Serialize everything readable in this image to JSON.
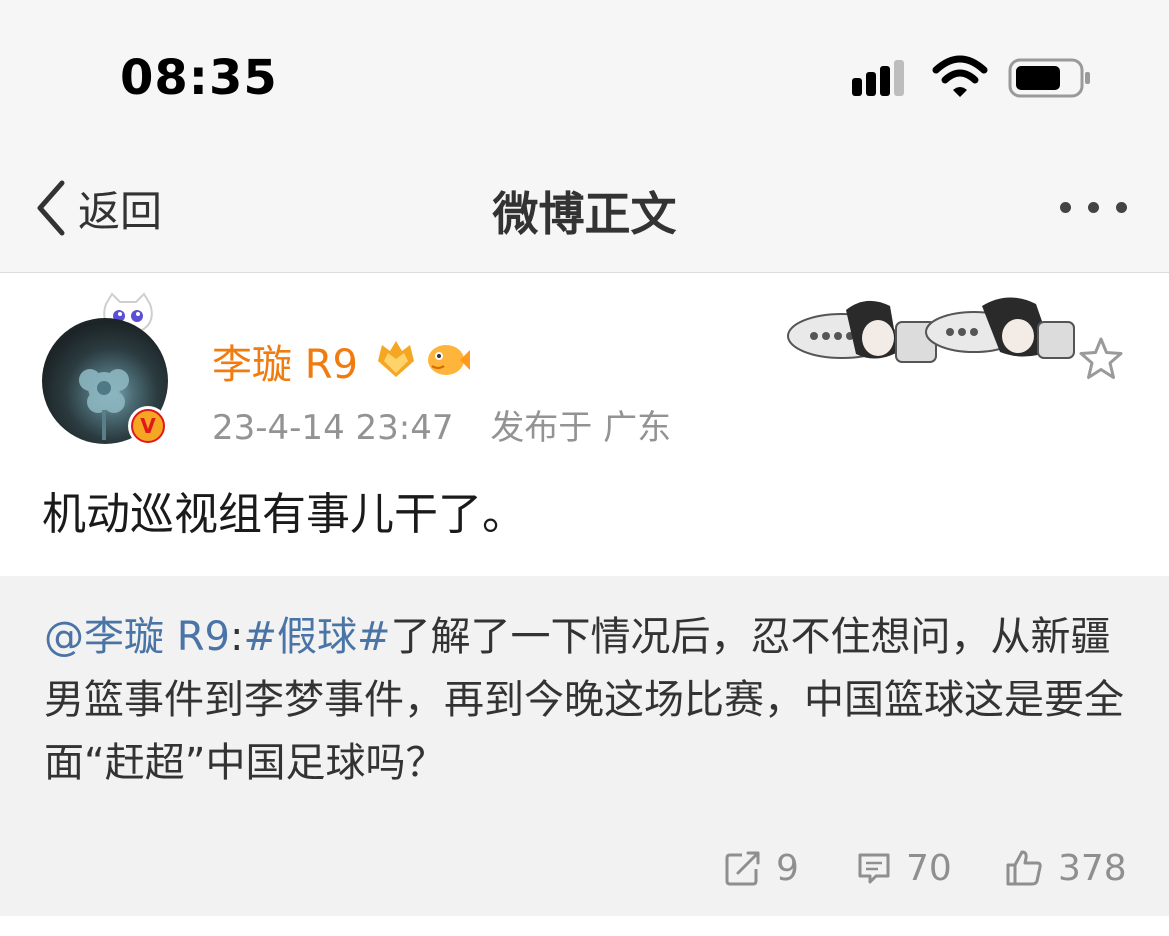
{
  "status_bar": {
    "time": "08:35"
  },
  "navbar": {
    "back_label": "返回",
    "title": "微博正文"
  },
  "post": {
    "author": "李璇 R9",
    "timestamp": "23-4-14 23:47",
    "source": "发布于 广东",
    "text": "机动巡视组有事儿干了。"
  },
  "repost": {
    "mention": "@李璇 R9",
    "colon": ":",
    "hashtag": "#假球#",
    "text": "了解了一下情况后，忍不住想问，从新疆男篮事件到李梦事件，再到今晚这场比赛，中国篮球这是要全面“赶超”中国足球吗？",
    "actions": {
      "reposts": "9",
      "comments": "70",
      "likes": "378"
    }
  },
  "colors": {
    "username": "#f07c0f",
    "link": "#4a74a6",
    "meta": "#939393",
    "verified": "#f5a623"
  },
  "icons": [
    "signal-icon",
    "wifi-icon",
    "battery-icon",
    "back-chevron-icon",
    "more-icon",
    "verified-icon",
    "vip-badge-icon",
    "fish-badge-icon",
    "star-icon",
    "repost-icon",
    "comment-icon",
    "like-icon"
  ]
}
